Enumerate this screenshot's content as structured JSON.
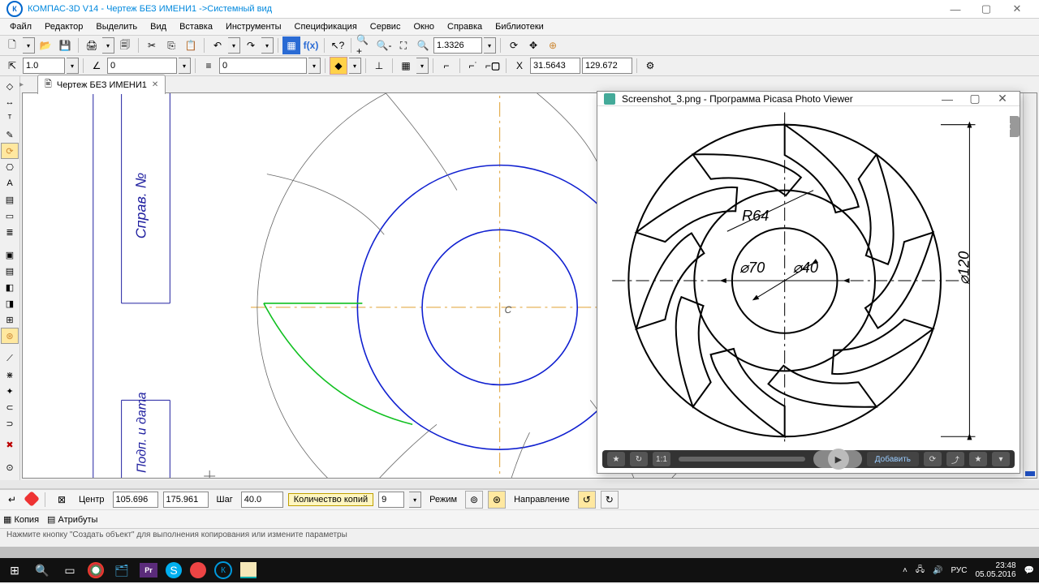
{
  "window": {
    "title": "КОМПАС-3D V14 - Чертеж БЕЗ ИМЕНИ1 ->Системный вид"
  },
  "menu": [
    "Файл",
    "Редактор",
    "Выделить",
    "Вид",
    "Вставка",
    "Инструменты",
    "Спецификация",
    "Сервис",
    "Окно",
    "Справка",
    "Библиотеки"
  ],
  "tab": {
    "label": "Чертеж БЕЗ ИМЕНИ1"
  },
  "tb2": {
    "step": "1.0",
    "angle": "0",
    "style": "0",
    "zoom": "1.3326",
    "coordx": "31.5643",
    "coordy": "129.672"
  },
  "params": {
    "center_label": "Центр",
    "cx": "105.696",
    "cy": "175.961",
    "step_label": "Шаг",
    "step": "40.0",
    "copies_label": "Количество копий",
    "copies": "9",
    "mode_label": "Режим",
    "dir_label": "Направление"
  },
  "tabs": {
    "copy": "Копия",
    "attr": "Атрибуты"
  },
  "status": "Нажмите кнопку \"Создать объект\" для выполнения копирования или измените параметры",
  "picasa": {
    "title": "Screenshot_3.png - Программа Picasa Photo Viewer",
    "add": "Добавить",
    "ratio": "1:1",
    "dims": {
      "R": "R64",
      "d1": "⌀70",
      "d2": "⌀40",
      "d3": "⌀120"
    }
  },
  "taskbar": {
    "lang": "РУС",
    "time": "23:48",
    "date": "05.05.2016"
  },
  "canvas": {
    "center_mark": "C",
    "frame_text1": "Справ. №",
    "frame_text2": "Подп. и дата"
  }
}
